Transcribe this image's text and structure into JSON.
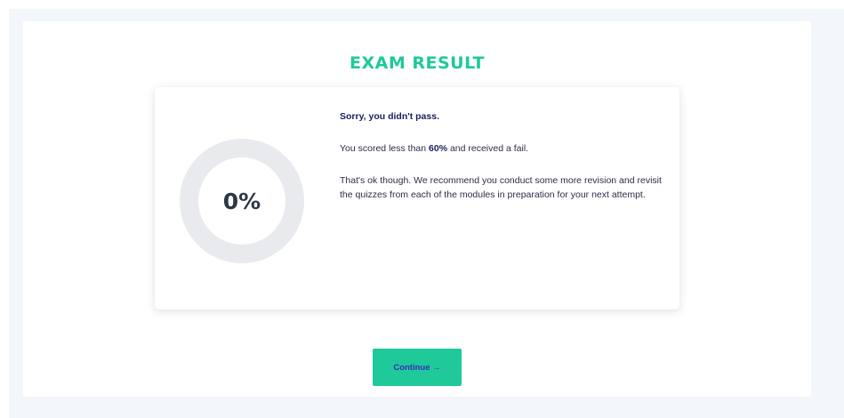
{
  "page": {
    "title": "EXAM RESULT"
  },
  "result": {
    "score_percent": 0,
    "score_label": "0%",
    "heading": "Sorry, you didn't pass.",
    "score_line_prefix": "You scored less than ",
    "pass_threshold": "60%",
    "score_line_suffix": " and received a fail.",
    "advice": "That's ok though. We recommend you conduct some more revision and revisit the quizzes from each of the modules in preparation for your next attempt."
  },
  "actions": {
    "continue_label": "Continue",
    "continue_icon": "arrow-right-icon",
    "continue_glyph": "→"
  },
  "colors": {
    "accent": "#1fc99a",
    "ring_track": "#e9eaee",
    "heading_text": "#1a1f5e",
    "button_text": "#3a2fb8",
    "background": "#f3f6fa"
  }
}
